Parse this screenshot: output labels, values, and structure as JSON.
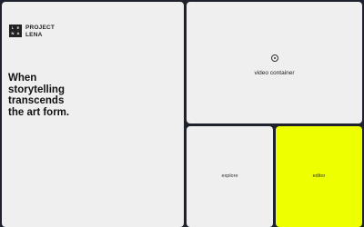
{
  "brand": {
    "logo_letters": [
      "L",
      "E",
      "N",
      "A"
    ],
    "name_line1": "PROJECT",
    "name_line2": "LENA"
  },
  "hero": {
    "line1": "When",
    "line2": "storytelling",
    "line3": "transcends",
    "line4": "the art form."
  },
  "video": {
    "icon": "play-circle-icon",
    "label": "video container"
  },
  "tiles": {
    "explore_label": "explore",
    "editor_label": "editor"
  },
  "colors": {
    "background": "#1f222d",
    "card": "#efefef",
    "accent": "#eeff00"
  }
}
